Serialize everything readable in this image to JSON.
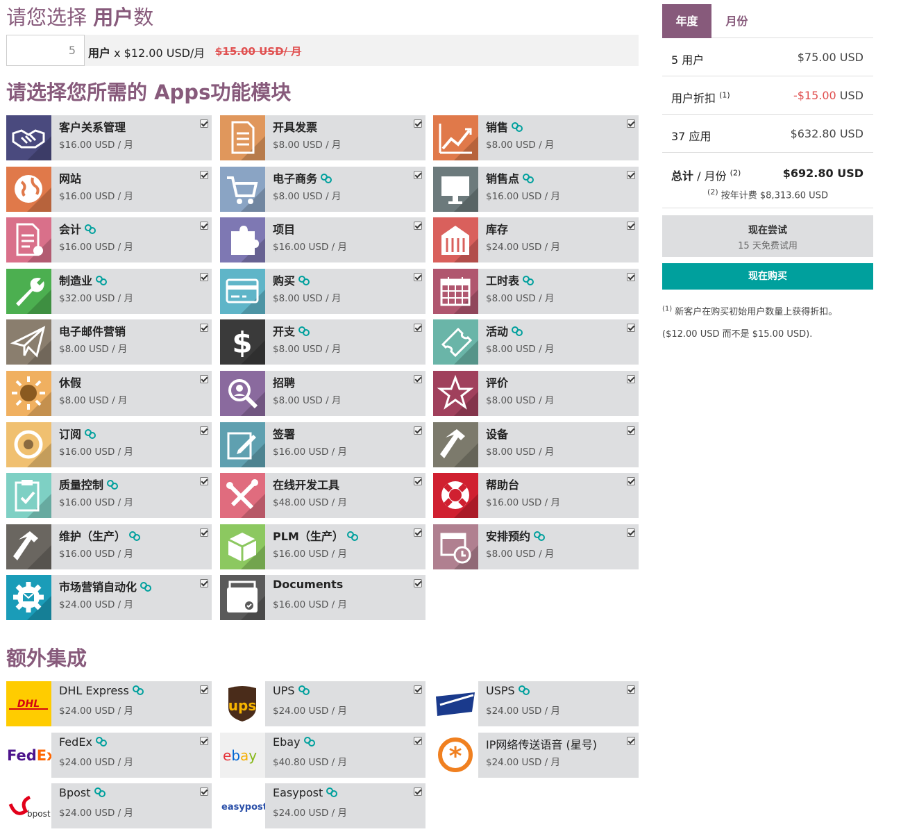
{
  "header": {
    "users_title_prefix": "请您选择 ",
    "users_title_bold": "用户",
    "users_title_suffix": "数",
    "users_count": "5",
    "users_price_bold": "用户",
    "users_price_rest": " x $12.00 USD/月",
    "users_old_price": "$15.00 USD/ 月",
    "apps_title_prefix": "请选择您所需的 ",
    "apps_title_bold": "Apps",
    "apps_title_suffix": "功能模块",
    "extra_title_prefix": "额外",
    "extra_title_bold": "集成"
  },
  "apps": [
    {
      "name": "客户关系管理",
      "price": "$16.00 USD / 月",
      "link": false,
      "icon": "handshake-icon",
      "color": "#4a4a7e"
    },
    {
      "name": "开具发票",
      "price": "$8.00 USD / 月",
      "link": false,
      "icon": "invoice-icon",
      "color": "#e0975c"
    },
    {
      "name": "销售",
      "price": "$8.00 USD / 月",
      "link": true,
      "icon": "chart-line-icon",
      "color": "#e0794a"
    },
    {
      "name": "网站",
      "price": "$16.00 USD / 月",
      "link": false,
      "icon": "globe-icon",
      "color": "#e0794a"
    },
    {
      "name": "电子商务",
      "price": "$8.00 USD / 月",
      "link": true,
      "icon": "cart-icon",
      "color": "#8aa4c4"
    },
    {
      "name": "销售点",
      "price": "$16.00 USD / 月",
      "link": true,
      "icon": "monitor-icon",
      "color": "#6c7a7c"
    },
    {
      "name": "会计",
      "price": "$16.00 USD / 月",
      "link": true,
      "icon": "accounting-icon",
      "color": "#d9708a"
    },
    {
      "name": "项目",
      "price": "$16.00 USD / 月",
      "link": false,
      "icon": "puzzle-icon",
      "color": "#7e78b3"
    },
    {
      "name": "库存",
      "price": "$24.00 USD / 月",
      "link": false,
      "icon": "warehouse-icon",
      "color": "#d9605c"
    },
    {
      "name": "制造业",
      "price": "$32.00 USD / 月",
      "link": true,
      "icon": "wrench-icon",
      "color": "#4caf50"
    },
    {
      "name": "购买",
      "price": "$8.00 USD / 月",
      "link": true,
      "icon": "credit-card-icon",
      "color": "#5fb5c8"
    },
    {
      "name": "工时表",
      "price": "$8.00 USD / 月",
      "link": true,
      "icon": "calendar-icon",
      "color": "#b0566f"
    },
    {
      "name": "电子邮件营销",
      "price": "$8.00 USD / 月",
      "link": false,
      "icon": "paper-plane-icon",
      "color": "#8a7e6e"
    },
    {
      "name": "开支",
      "price": "$8.00 USD / 月",
      "link": true,
      "icon": "dollar-icon",
      "color": "#3a3a3a"
    },
    {
      "name": "活动",
      "price": "$8.00 USD / 月",
      "link": true,
      "icon": "ticket-icon",
      "color": "#6ab5a8"
    },
    {
      "name": "休假",
      "price": "$8.00 USD / 月",
      "link": false,
      "icon": "sun-icon",
      "color": "#f0b060"
    },
    {
      "name": "招聘",
      "price": "$8.00 USD / 月",
      "link": false,
      "icon": "magnifier-icon",
      "color": "#8a6a9e"
    },
    {
      "name": "评价",
      "price": "$8.00 USD / 月",
      "link": false,
      "icon": "star-icon",
      "color": "#a0405c"
    },
    {
      "name": "订阅",
      "price": "$16.00 USD / 月",
      "link": true,
      "icon": "recycle-icon",
      "color": "#f0c070"
    },
    {
      "name": "签署",
      "price": "$16.00 USD / 月",
      "link": false,
      "icon": "pen-icon",
      "color": "#5fa0b0"
    },
    {
      "name": "设备",
      "price": "$8.00 USD / 月",
      "link": false,
      "icon": "hammer-icon",
      "color": "#7c7a6c"
    },
    {
      "name": "质量控制",
      "price": "$16.00 USD / 月",
      "link": true,
      "icon": "clipboard-icon",
      "color": "#7ed0c4"
    },
    {
      "name": "在线开发工具",
      "price": "$48.00 USD / 月",
      "link": false,
      "icon": "tools-icon",
      "color": "#e06c7e"
    },
    {
      "name": "帮助台",
      "price": "$16.00 USD / 月",
      "link": false,
      "icon": "lifebuoy-icon",
      "color": "#d02030"
    },
    {
      "name": "维护（生产）",
      "price": "$16.00 USD / 月",
      "link": true,
      "icon": "hammer-icon",
      "color": "#6a6660"
    },
    {
      "name": "PLM（生产）",
      "price": "$16.00 USD / 月",
      "link": true,
      "icon": "box-icon",
      "color": "#8cc860"
    },
    {
      "name": "安排预约",
      "price": "$8.00 USD / 月",
      "link": true,
      "icon": "calendar-clock-icon",
      "color": "#b08090"
    },
    {
      "name": "市场营销自动化",
      "price": "$24.00 USD / 月",
      "link": true,
      "icon": "gear-mail-icon",
      "color": "#1a9cb8"
    },
    {
      "name": "Documents",
      "price": "$16.00 USD / 月",
      "link": false,
      "icon": "archive-icon",
      "color": "#5a5a5a"
    }
  ],
  "extras": [
    {
      "name": "DHL Express",
      "price": "$24.00 USD / 月",
      "link": true,
      "icon": "dhl-logo"
    },
    {
      "name": "UPS",
      "price": "$24.00 USD / 月",
      "link": true,
      "icon": "ups-logo"
    },
    {
      "name": "USPS",
      "price": "$24.00 USD / 月",
      "link": true,
      "icon": "usps-logo"
    },
    {
      "name": "FedEx",
      "price": "$24.00 USD / 月",
      "link": true,
      "icon": "fedex-logo"
    },
    {
      "name": "Ebay",
      "price": "$40.80 USD / 月",
      "link": true,
      "icon": "ebay-logo"
    },
    {
      "name": "IP网络传送语音 (星号)",
      "price": "$24.00 USD / 月",
      "link": false,
      "icon": "asterisk-logo"
    },
    {
      "name": "Bpost",
      "price": "$24.00 USD / 月",
      "link": true,
      "icon": "bpost-logo"
    },
    {
      "name": "Easypost",
      "price": "$24.00 USD / 月",
      "link": true,
      "icon": "easypost-logo"
    }
  ],
  "summary": {
    "tab_yearly": "年度",
    "tab_monthly": "月份",
    "users_label": "5 用户",
    "users_value": "$75.00 USD",
    "discount_label": "用户折扣 ",
    "discount_sup": "(1)",
    "discount_value_red": "-$15.00",
    "discount_value_unit": " USD",
    "apps_label": "37 应用",
    "apps_value": "$632.80 USD",
    "total_label_bold": "总计",
    "total_label_rest": " / 月份 ",
    "total_sup": "(2)",
    "total_value": "$692.80 USD",
    "annual_sup": "(2)",
    "annual_text": " 按年计费 $8,313.60 USD",
    "try_title": "现在尝试",
    "try_sub": "15 天免费试用",
    "buy_label": "现在购买",
    "note1_sup": "(1)",
    "note1_text": " 新客户在购买初始用户数量上获得折扣。",
    "note2_text": "($12.00 USD 而不是 $15.00 USD)."
  },
  "colors": {
    "brand": "#875a7b",
    "buy": "#00a09d",
    "discount": "#e05050",
    "link": "#00a09d"
  }
}
